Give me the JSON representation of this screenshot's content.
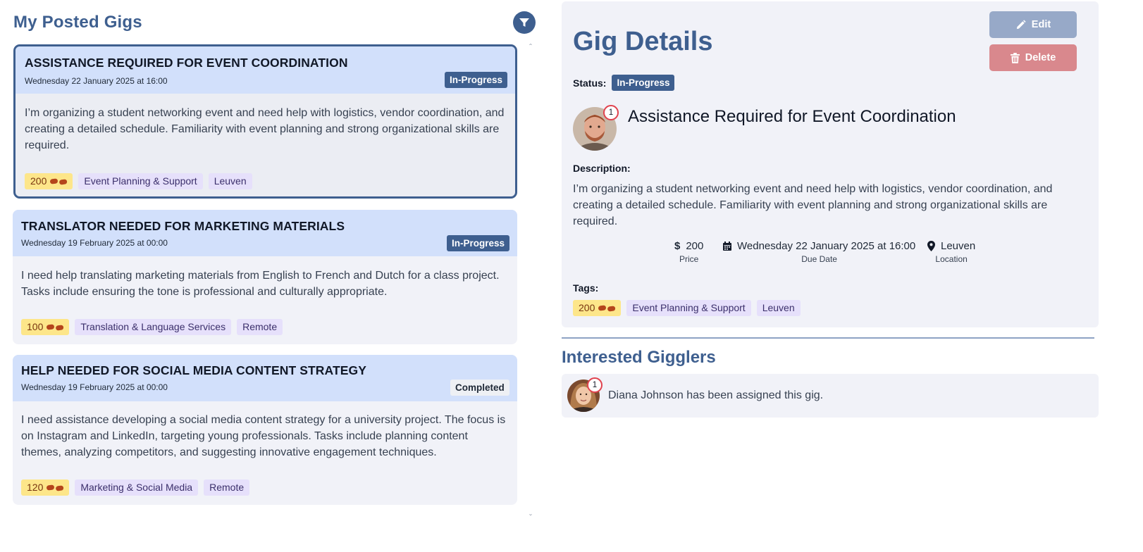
{
  "left": {
    "title": "My Posted Gigs",
    "filter_icon": "filter-icon",
    "gigs": [
      {
        "title": "ASSISTANCE REQUIRED FOR EVENT COORDINATION",
        "date": "Wednesday 22 January 2025 at 16:00",
        "status": "In-Progress",
        "description": "I’m organizing a student networking event and need help with logistics, vendor coordination, and creating a detailed schedule. Familiarity with event planning and strong organizational skills are required.",
        "price": "200",
        "tags": [
          "Event Planning & Support",
          "Leuven"
        ]
      },
      {
        "title": "TRANSLATOR NEEDED FOR MARKETING MATERIALS",
        "date": "Wednesday 19 February 2025 at 00:00",
        "status": "In-Progress",
        "description": "I need help translating marketing materials from English to French and Dutch for a class project. Tasks include ensuring the tone is professional and culturally appropriate.",
        "price": "100",
        "tags": [
          "Translation & Language Services",
          "Remote"
        ]
      },
      {
        "title": "HELP NEEDED FOR SOCIAL MEDIA CONTENT STRATEGY",
        "date": "Wednesday 19 February 2025 at 00:00",
        "status": "Completed",
        "description": "I need assistance developing a social media content strategy for a university project. The focus is on Instagram and LinkedIn, targeting young professionals. Tasks include planning content themes, analyzing competitors, and suggesting innovative engagement techniques.",
        "price": "120",
        "tags": [
          "Marketing & Social Media",
          "Remote"
        ]
      }
    ]
  },
  "details": {
    "title": "Gig Details",
    "edit_label": "Edit",
    "delete_label": "Delete",
    "status_label": "Status:",
    "status": "In-Progress",
    "notification_count": "1",
    "heading": "Assistance Required for Event Coordination",
    "description_label": "Description:",
    "description": "I’m organizing a student networking event and need help with logistics, vendor coordination, and creating a detailed schedule. Familiarity with event planning and strong organizational skills are required.",
    "price": "200",
    "price_label": "Price",
    "due_date": "Wednesday 22 January 2025 at 16:00",
    "due_date_label": "Due Date",
    "location": "Leuven",
    "location_label": "Location",
    "tags_label": "Tags:",
    "tags": [
      "Event Planning & Support",
      "Leuven"
    ]
  },
  "interested": {
    "title": "Interested Gigglers",
    "notification_count": "1",
    "assigned_text": "Diana Johnson has been assigned this gig."
  },
  "colors": {
    "primary": "#3e5f8f",
    "card_header": "#d2e0fb",
    "card_body": "#f1f2f8",
    "price_tag": "#fde68a",
    "category_tag": "#e6e0fb",
    "delete": "#d9888d",
    "edit": "#97a9c8"
  }
}
